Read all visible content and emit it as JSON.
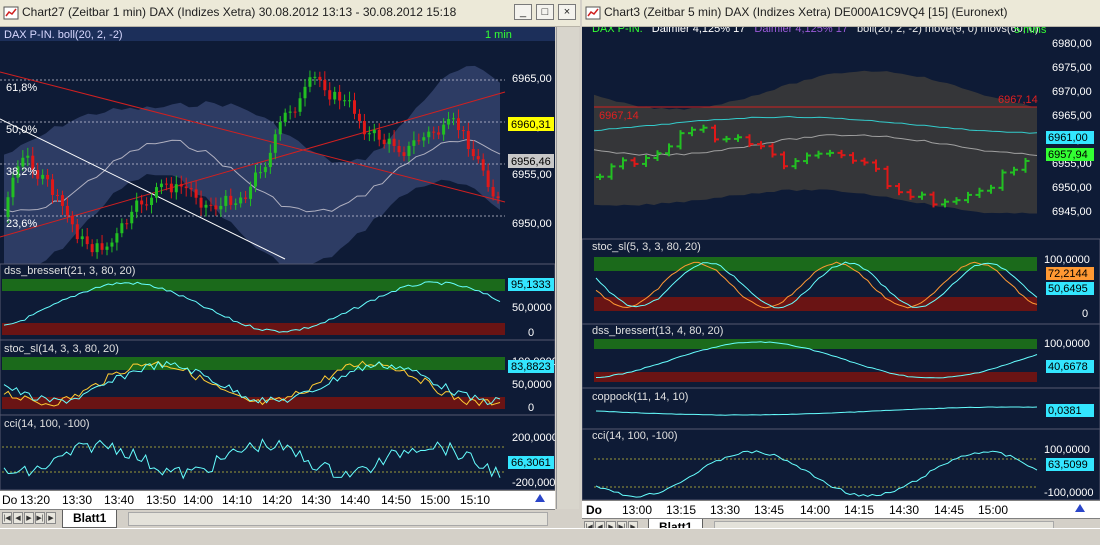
{
  "left": {
    "title": "Chart27 (Zeitbar 1 min)  DAX (Indizes Xetra) 30.08.2012 13:13 - 30.08.2012 15:18",
    "main_legend": "DAX P-IN. boll(20, 2, -2)",
    "interval": "1 min",
    "fib_levels": [
      "61,8%",
      "50,0%",
      "38,2%",
      "23,6%"
    ],
    "price_axis": [
      "6965,00",
      "6960,00",
      "6955,00",
      "6950,00"
    ],
    "badges": {
      "price_current": "6960,31",
      "price_other": "6956,46"
    },
    "panes": [
      {
        "legend": "dss_bressert(21, 3, 80, 20)",
        "axis": [
          "50,0000",
          "0"
        ],
        "badge": "95,1333"
      },
      {
        "legend": "stoc_sl(14, 3, 3, 80, 20)",
        "axis": [
          "100,0000",
          "50,0000",
          "0"
        ],
        "badge": "83,8823"
      },
      {
        "legend": "cci(14, 100, -100)",
        "axis": [
          "200,0000",
          "0",
          "-200,0000"
        ],
        "badge": "66,3061"
      }
    ],
    "time_axis": [
      "Do",
      "13:20",
      "13:30",
      "13:40",
      "13:50",
      "14:00",
      "14:10",
      "14:20",
      "14:30",
      "14:40",
      "14:50",
      "15:00",
      "15:10"
    ],
    "sheet_tab": "Blatt1"
  },
  "right": {
    "title": "Chart3 (Zeitbar 5 min)  DAX (Indizes Xetra) DE000A1C9VQ4 [15] (Euronext)",
    "legend": {
      "symbol": "DAX P-IN.",
      "daimler1": "Daimler  4,125% 17",
      "daimler2": "Daimler  4,125% 17",
      "rest": "boll(20, 2, -2) move(9, 0) movs(60, 0)"
    },
    "interval": "5 mins",
    "price_axis": [
      "6980,00",
      "6975,00",
      "6970,00",
      "6965,00",
      "6960,00",
      "6955,00",
      "6950,00",
      "6945,00"
    ],
    "hline_label_left": "6967,14",
    "hline_label_right": "6967,14",
    "badges": {
      "a": "6961,00",
      "b": "6957,94"
    },
    "panes": [
      {
        "legend": "stoc_sl(5, 3, 3, 80, 20)",
        "axis": [
          "100,0000",
          "0"
        ],
        "badges": [
          "72,2144",
          "50,6495"
        ]
      },
      {
        "legend": "dss_bressert(13, 4, 80, 20)",
        "axis": [
          "100,0000"
        ],
        "badges": [
          "40,6678"
        ]
      },
      {
        "legend": "coppock(11, 14, 10)",
        "axis": [],
        "badges": [
          "0,0381"
        ]
      },
      {
        "legend": "cci(14, 100, -100)",
        "axis": [
          "100,0000",
          "-100,0000"
        ],
        "badges": [
          "63,5099"
        ]
      }
    ],
    "time_axis": [
      "Do",
      "13:00",
      "13:15",
      "13:30",
      "13:45",
      "14:00",
      "14:15",
      "14:30",
      "14:45",
      "15:00"
    ],
    "sheet_tab": "Blatt1"
  },
  "window_buttons": {
    "minimize": "_",
    "maximize": "□",
    "close": "×"
  },
  "colors": {
    "background": "#0e1b36",
    "up": "#22c022",
    "down": "#e01818",
    "green_zone": "#1b6a1b",
    "red_zone": "#6a1414",
    "badge_yellow": "#ffff00",
    "badge_cyan": "#33e6ff"
  }
}
